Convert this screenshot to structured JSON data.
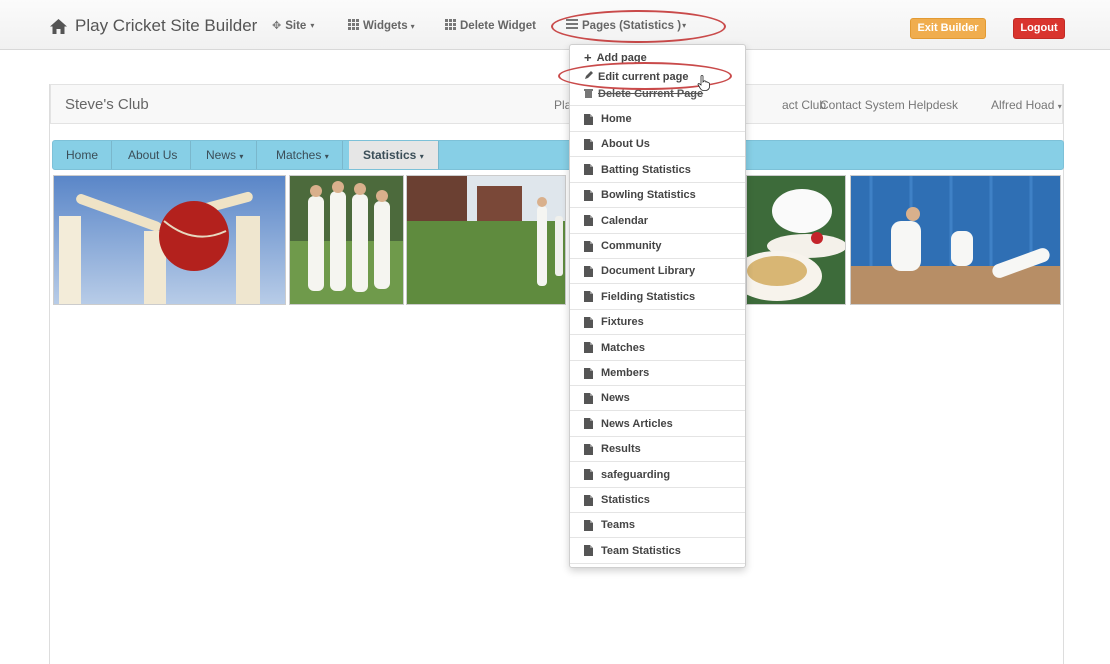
{
  "builder": {
    "title": "Play Cricket Site Builder",
    "site_label": "Site",
    "widgets_label": "Widgets",
    "delete_widget_label": "Delete Widget",
    "pages_label": "Pages  (Statistics )",
    "exit_label": "Exit Builder",
    "logout_label": "Logout",
    "colors": {
      "exit": "#f0ad4e",
      "logout": "#d9342e",
      "highlight_oval": "#c94a4a"
    }
  },
  "site": {
    "club_name": "Steve's Club",
    "top_links": {
      "play": "Pla",
      "contact_club": "act Club",
      "helpdesk": "Contact System Helpdesk",
      "user": "Alfred Hoad"
    },
    "nav": [
      {
        "label": "Home",
        "caret": false
      },
      {
        "label": "About Us",
        "caret": false
      },
      {
        "label": "News",
        "caret": true
      },
      {
        "label": "Matches",
        "caret": true
      },
      {
        "label": "Statistics",
        "caret": true
      }
    ],
    "nav_color": "#87cfe6"
  },
  "pages_dropdown": {
    "actions": [
      {
        "label": "Add page",
        "icon": "plus-icon"
      },
      {
        "label": "Edit current page",
        "icon": "pencil-icon"
      },
      {
        "label": "Delete Current Page",
        "icon": "trash-icon"
      }
    ],
    "pages": [
      "Home",
      "About Us",
      "Batting Statistics",
      "Bowling Statistics",
      "Calendar",
      "Community",
      "Document Library",
      "Fielding Statistics",
      "Fixtures",
      "Matches",
      "Members",
      "News",
      "News Articles",
      "Results",
      "safeguarding",
      "Statistics",
      "Teams",
      "Team Statistics"
    ]
  }
}
